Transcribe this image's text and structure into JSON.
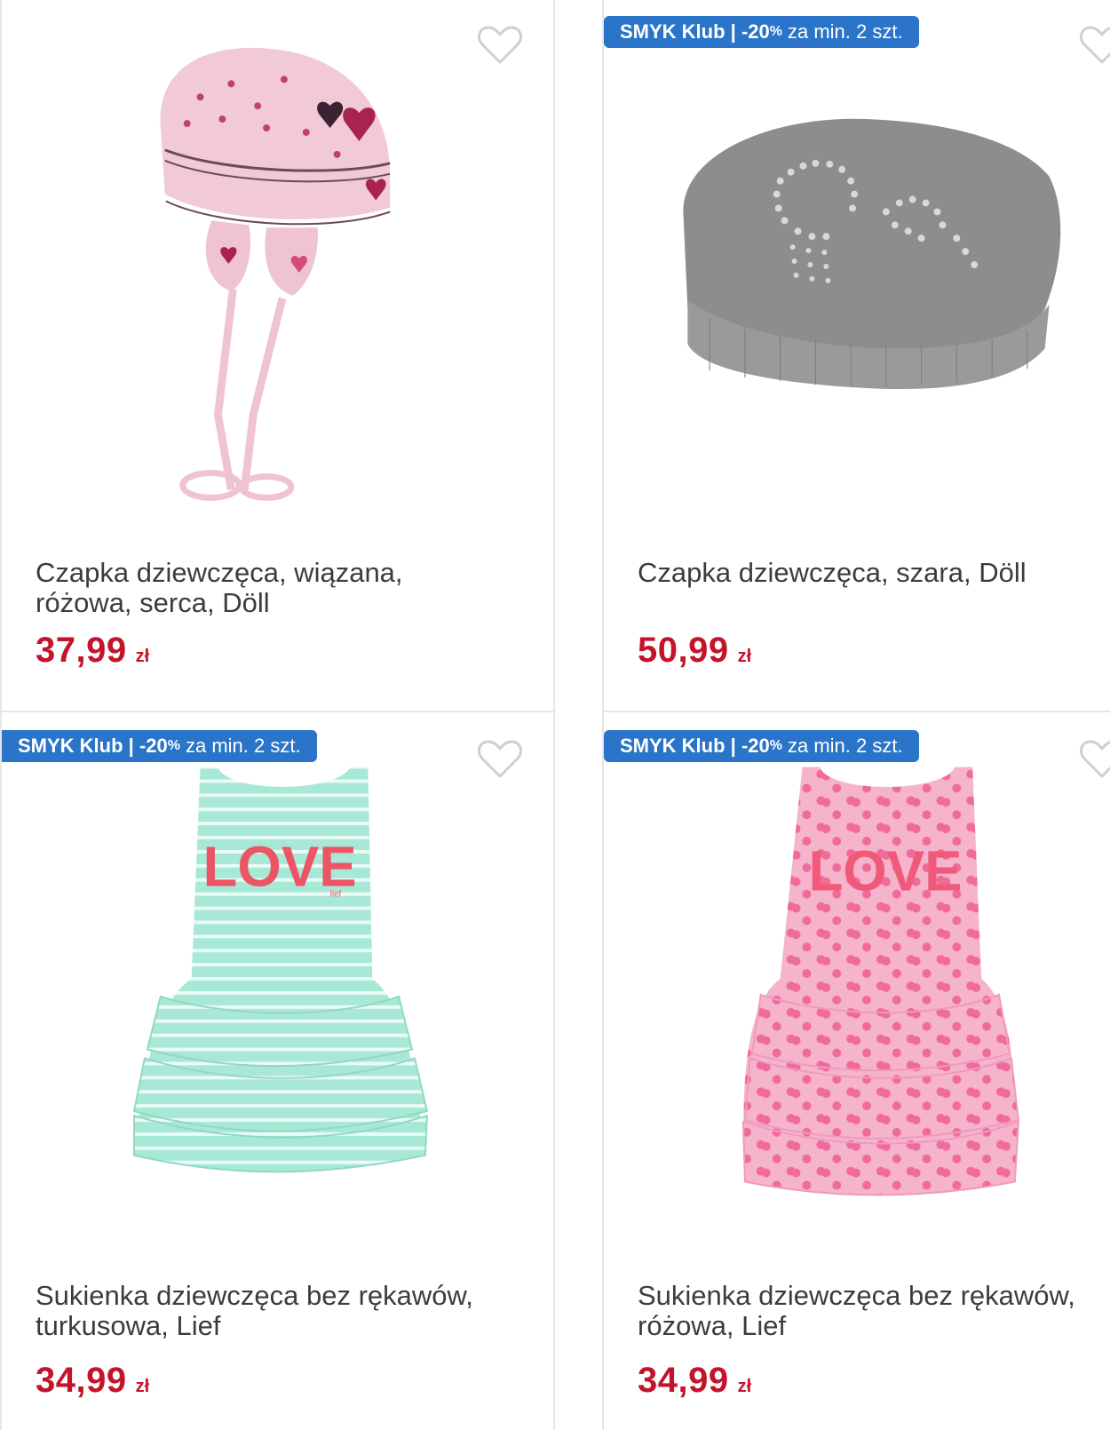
{
  "colors": {
    "badge": "#2a74c9",
    "price": "#c4142b",
    "title": "#3c3c3c",
    "heart": "#cfcfcf"
  },
  "products": [
    {
      "title": "Czapka dziewczęca, wiązana,\nróżowa, serca, Döll",
      "price": "37,99",
      "currency": "zł",
      "badge": null,
      "image": "pink-baby-hat-hearts",
      "favorite_icon": "heart-outline-icon"
    },
    {
      "title": "Czapka dziewczęca, szara, Döll",
      "price": "50,99",
      "currency": "zł",
      "badge": {
        "brand": "SMYK Klub",
        "sep": " | ",
        "discount": "-20",
        "pct": "%",
        "text": "za min. 2 szt."
      },
      "image": "gray-beanie-rhinestones",
      "favorite_icon": "heart-outline-icon"
    },
    {
      "title": "Sukienka dziewczęca bez rękawów,\nturkusowa, Lief",
      "price": "34,99",
      "currency": "zł",
      "badge": {
        "brand": "SMYK Klub",
        "sep": " | ",
        "discount": "-20",
        "pct": "%",
        "text": "za min. 2 szt."
      },
      "image": "mint-striped-dress-love",
      "favorite_icon": "heart-outline-icon"
    },
    {
      "title": "Sukienka dziewczęca bez rękawów,\nróżowa, Lief",
      "price": "34,99",
      "currency": "zł",
      "badge": {
        "brand": "SMYK Klub",
        "sep": " | ",
        "discount": "-20",
        "pct": "%",
        "text": "za min. 2 szt."
      },
      "image": "pink-cherry-dress-love",
      "favorite_icon": "heart-outline-icon"
    }
  ]
}
